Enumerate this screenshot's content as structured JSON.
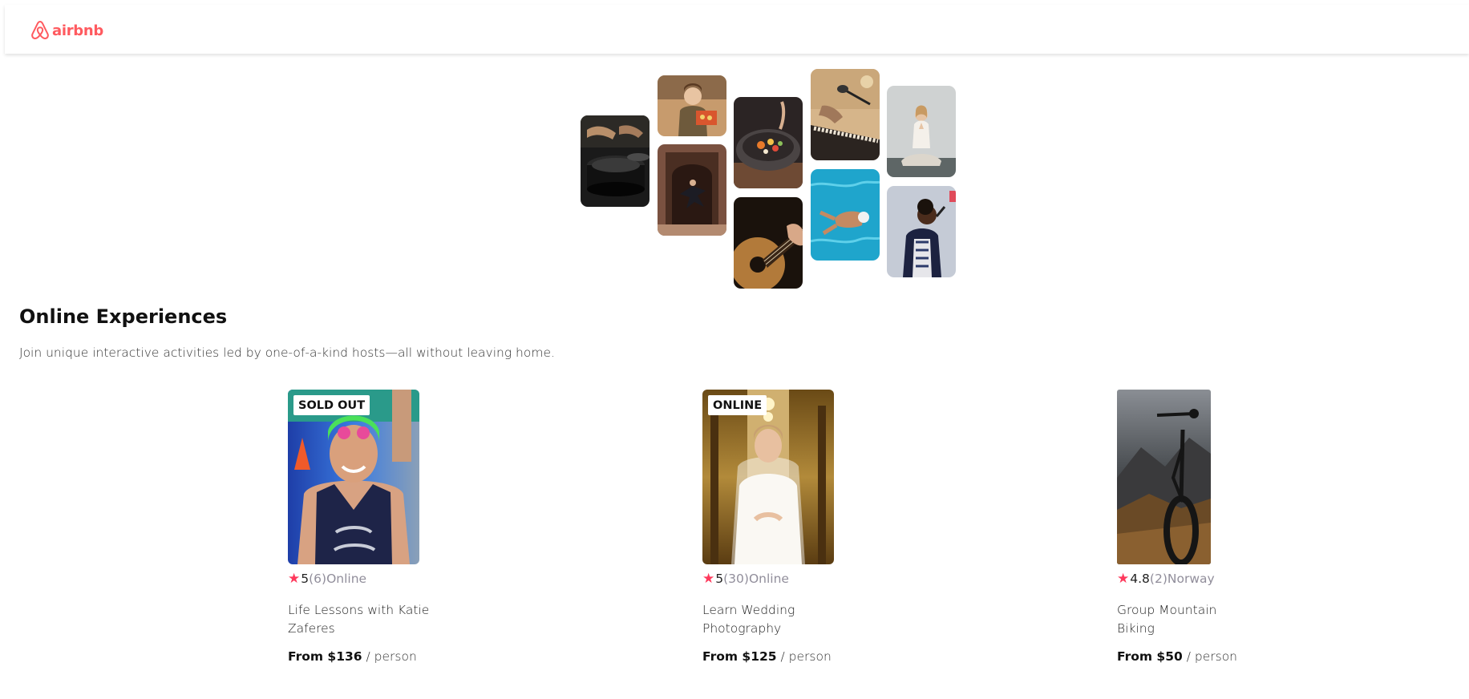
{
  "header": {
    "logo_text": "airbnb",
    "brand_color": "#FF5A5F"
  },
  "hero": {
    "photos": [
      "cooking",
      "chef-with-tray",
      "bowl-of-food",
      "microphone-and-keyboard",
      "meditation",
      "dancer-in-doorway",
      "guitar",
      "swimmer",
      "singer"
    ]
  },
  "section": {
    "title": "Online Experiences",
    "subtitle": "Join unique interactive activities led by one-of-a-kind hosts—all without leaving home."
  },
  "cards": [
    {
      "badge": "SOLD OUT",
      "rating": "5",
      "review_count": "(6)",
      "location": "Online",
      "title": "Life Lessons with Katie Zaferes",
      "price_from": "From $136",
      "price_unit": " / person"
    },
    {
      "badge": "ONLINE",
      "rating": "5",
      "review_count": "(30)",
      "location": "Online",
      "title": "Learn Wedding Photography",
      "price_from": "From $125",
      "price_unit": " / person"
    },
    {
      "badge": "",
      "rating": "4.8",
      "review_count": "(2)",
      "location": "Norway",
      "title": "Group Mountain Biking",
      "price_from": "From $50",
      "price_unit": " / person"
    }
  ],
  "colors": {
    "star": "#FE395C",
    "muted_text": "#918E9B"
  }
}
